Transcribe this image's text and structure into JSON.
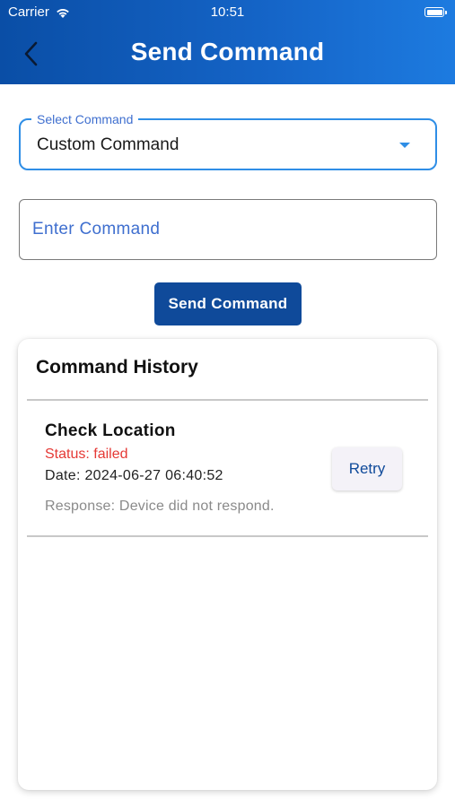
{
  "status_bar": {
    "carrier": "Carrier",
    "time": "10:51"
  },
  "header": {
    "title": "Send Command",
    "back_icon": "chevron-left-icon"
  },
  "select_command": {
    "label": "Select Command",
    "value": "Custom Command"
  },
  "command_input": {
    "placeholder": "Enter Command",
    "value": ""
  },
  "send_button": {
    "label": "Send Command"
  },
  "history": {
    "title": "Command History",
    "items": [
      {
        "name": "Check Location",
        "status": "Status: failed",
        "date": "Date: 2024-06-27 06:40:52",
        "response": "Response: Device did not respond.",
        "retry_label": "Retry"
      }
    ]
  },
  "colors": {
    "header_gradient_start": "#0a4ea6",
    "header_gradient_end": "#1d7be0",
    "accent": "#2f8ee6",
    "primary_button": "#0f4a9a",
    "status_failed": "#e53935"
  }
}
